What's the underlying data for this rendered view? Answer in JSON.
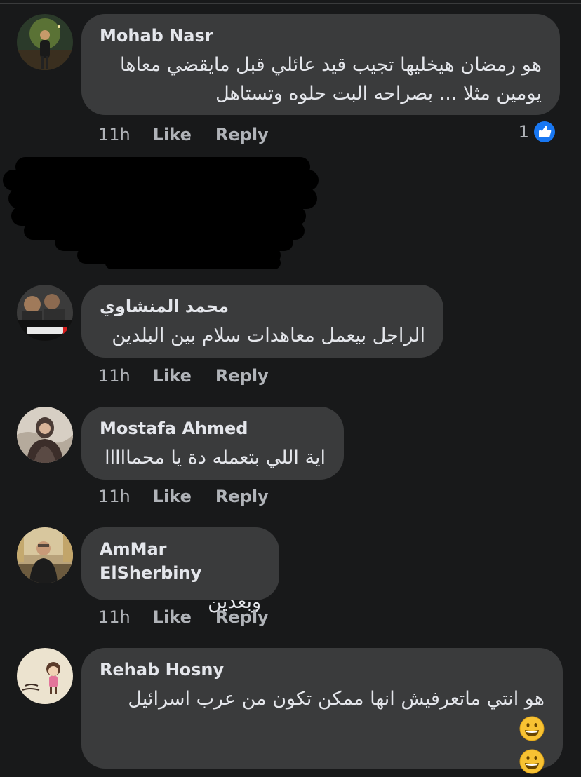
{
  "comments": [
    {
      "author": "Mohab Nasr",
      "text_lines": [
        "هو رمضان هيخليها تجيب قيد عائلي قبل مايقضي معاها",
        "يومين مثلا ... بصراحه البت حلوه وتستاهل"
      ],
      "time": "11h",
      "like_label": "Like",
      "reply_label": "Reply",
      "reaction_count": "1",
      "reaction_icon": "like-reaction-icon"
    },
    {
      "author": "محمد المنشاوي",
      "text_lines": [
        "الراجل بيعمل معاهدات سلام بين البلدين"
      ],
      "time": "11h",
      "like_label": "Like",
      "reply_label": "Reply"
    },
    {
      "author": "Mostafa Ahmed",
      "text_lines": [
        "اية اللي بتعمله دة يا محمااااا"
      ],
      "time": "11h",
      "like_label": "Like",
      "reply_label": "Reply"
    },
    {
      "author": "AmMar ElSherbiny",
      "text_lines": [
        "وبعدين"
      ],
      "time": "11h",
      "like_label": "Like",
      "reply_label": "Reply"
    },
    {
      "author": "Rehab Hosny",
      "text_lines": [
        "هو انتي ماتعرفيش انها ممكن تكون من عرب اسرائيل"
      ],
      "emoji": "grinning-face-emoji"
    }
  ],
  "colors": {
    "background": "#18191a",
    "bubble": "#3a3b3c",
    "text": "#e4e6eb",
    "secondary_text": "#b0b3b8",
    "like_blue": "#1877f2",
    "redaction": "#000000"
  }
}
